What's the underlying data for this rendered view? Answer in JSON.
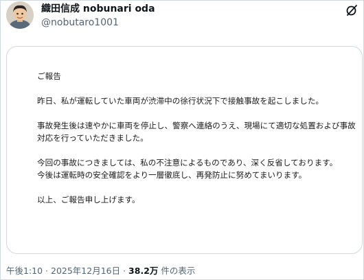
{
  "header": {
    "display_name": "織田信成 nobunari oda",
    "handle": "@nobutaro1001",
    "corner_icon": "grok-slash-icon"
  },
  "document": {
    "lines": [
      "ご報告",
      "",
      "昨日、私が運転していた車両が渋滞中の徐行状況下で接触事故を起こしました。",
      "",
      "事故発生後は速やかに車両を停止し、警察へ連絡のうえ、現場にて適切な処置および事故",
      "対応を行っていただきました。",
      "",
      "今回の事故につきましては、私の不注意によるものであり、深く反省しております。",
      "今後は運転時の安全確認をより一層徹底し、再発防止に努めてまいります。",
      "",
      "以上、ご報告申し上げます。"
    ]
  },
  "meta": {
    "time": "午後1:10",
    "sep1": " · ",
    "date": "2025年12月16日",
    "sep2": " · ",
    "views_count": "38.2万",
    "views_label": " 件の表示"
  },
  "colors": {
    "text": "#0f1419",
    "muted": "#536471",
    "border": "#cfd9de"
  }
}
